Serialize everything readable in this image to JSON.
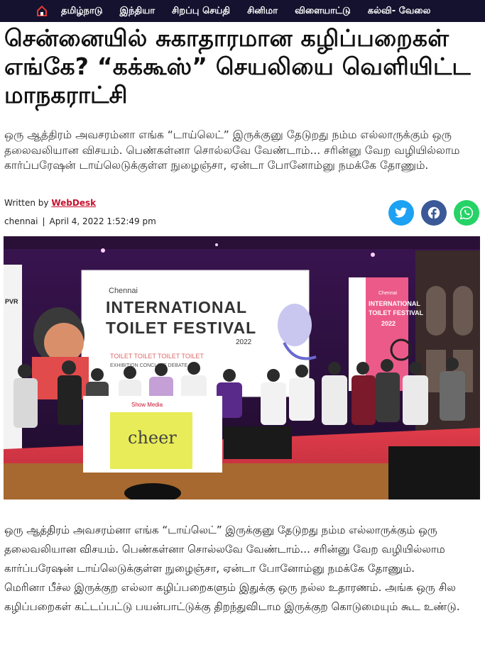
{
  "nav": {
    "home_icon": "home-icon",
    "items": [
      "தமிழ்நாடு",
      "இந்தியா",
      "சிறப்பு செய்தி",
      "சினிமா",
      "விளையாட்டு",
      "கல்வி- வேலை"
    ]
  },
  "article": {
    "headline": "சென்னையில் சுகாதாரமான கழிப்பறைகள் எங்கே? “கக்கூஸ்” செயலியை வெளியிட்ட மாநகராட்சி",
    "summary": "ஒரு ஆத்திரம் அவசரம்னா எங்க “டாய்லெட்” இருக்குனு தேடுறது நம்ம எல்லாருக்கும் ஒரு தலைவலியான விசயம். பெண்கள்னா சொல்லவே வேண்டாம்... சரின்னு வேற வழியில்லாம கார்ப்பரேஷன் டாய்லெடுக்குள்ள நுழைஞ்சா, ஏன்டா போனோம்னு நமக்கே தோணும்.",
    "written_by": "Written by",
    "author": "WebDesk",
    "location": "chennai",
    "separator": "|",
    "date": "April 4, 2022 1:52:49 pm",
    "body": [
      "ஒரு ஆத்திரம் அவசரம்னா எங்க “டாய்லெட்” இருக்குனு தேடுறது நம்ம எல்லாருக்கும் ஒரு தலைவலியான விசயம். பெண்கள்னா சொல்லவே வேண்டாம்... சரின்னு வேற வழியில்லாம கார்ப்பரேஷன் டாய்லெடுக்குள்ள நுழைஞ்சா, ஏன்டா போனோம்னு நமக்கே தோணும்.",
      "மெரினா பீச்ல இருக்குற எல்லா கழிப்பறைகளும் இதுக்கு ஒரு நல்ல உதாரணம். அங்க ஒரு சில கழிப்பறைகள் கட்டப்பட்டு பயன்பாட்டுக்கு திறந்துவிடாம இருக்குற கொடுமையும் கூட உண்டு."
    ]
  },
  "photo": {
    "banner_small": "Chennai",
    "banner_title_1": "INTERNATIONAL",
    "banner_title_2": "TOILET FESTIVAL",
    "banner_year": "2022",
    "banner_sub": "TOILET TOILET TOILET TOILET",
    "banner_sub2": "EXHIBITION   CONCLAVE   DEBATE",
    "right_small": "Chennai",
    "right_title_1": "INTERNATIONAL",
    "right_title_2": "TOILET FESTIVAL",
    "right_year": "2022",
    "podium_brand": "Show Media",
    "podium_logo": "cheer",
    "left_banner": "PVR"
  },
  "share": {
    "twitter": "twitter-icon",
    "facebook": "facebook-icon",
    "whatsapp": "whatsapp-icon"
  },
  "colors": {
    "nav_bg": "#14122e",
    "author_red": "#c8102e",
    "twitter": "#1da1f2",
    "facebook": "#3b5998",
    "whatsapp": "#25d366"
  }
}
